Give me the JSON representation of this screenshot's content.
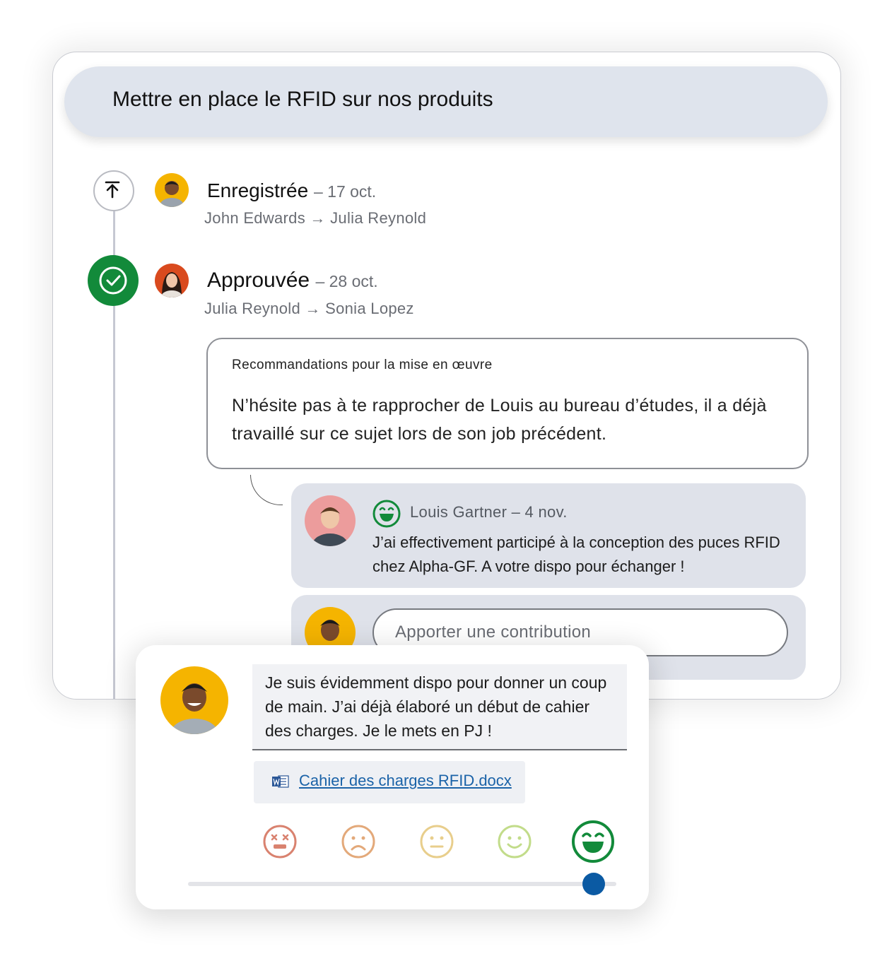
{
  "header": {
    "title": "Mettre en place le RFID sur nos produits"
  },
  "steps": [
    {
      "title": "Enregistrée",
      "date": "– 17 oct.",
      "people": "John Edwards → Julia Reynold"
    },
    {
      "title": "Approuvée",
      "date": "– 28 oct.",
      "people": "Julia Reynold → Sonia Lopez"
    }
  ],
  "recommendation": {
    "title": "Recommandations pour la mise en œuvre",
    "text": "N’hésite pas à te rapprocher de Louis au bureau d’études, il a déjà travaillé sur ce sujet lors de son job précédent."
  },
  "reply": {
    "meta": "Louis Gartner – 4 nov.",
    "text": "J’ai effectivement participé à la conception des puces RFID chez Alpha-GF. A votre dispo pour échanger !"
  },
  "contribution": {
    "placeholder": "Apporter une contribution"
  },
  "popup": {
    "message": "Je suis évidemment dispo pour donner un coup de main. J’ai déjà élaboré un début de cahier des charges. Je le mets en PJ !",
    "attachment": "Cahier des charges RFID.docx",
    "rating": {
      "selected_index": 4,
      "scale": 5
    }
  },
  "colors": {
    "header_bg": "#dfe4ed",
    "approved_green": "#128a3a",
    "link_blue": "#1b63a8",
    "slider_blue": "#0b5aa3",
    "emoji_1": "#d9826f",
    "emoji_2": "#e3a97a",
    "emoji_3": "#e8ce8c",
    "emoji_4": "#c2dc8a",
    "emoji_5": "#128a3a"
  }
}
